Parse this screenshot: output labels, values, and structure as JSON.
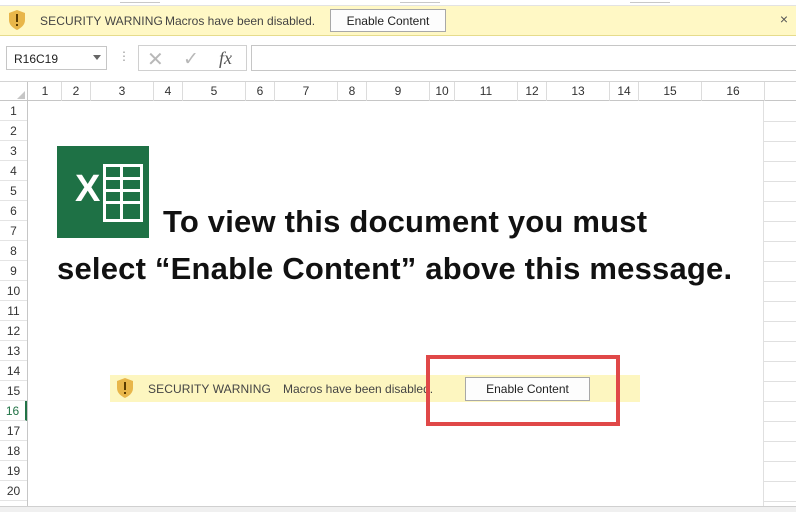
{
  "security_bar": {
    "title": "SECURITY WARNING",
    "message": "Macros have been disabled.",
    "button_label": "Enable Content",
    "close_glyph": "×"
  },
  "formula_bar": {
    "name_box_value": "R16C19",
    "dots": "⋮",
    "cancel_glyph": "✕",
    "enter_glyph": "✓",
    "function_label": "fx",
    "formula_value": ""
  },
  "columns": [
    "1",
    "2",
    "3",
    "4",
    "5",
    "6",
    "7",
    "8",
    "9",
    "10",
    "11",
    "12",
    "13",
    "14",
    "15",
    "16"
  ],
  "rows": [
    "1",
    "2",
    "3",
    "4",
    "5",
    "6",
    "7",
    "8",
    "9",
    "10",
    "11",
    "12",
    "13",
    "14",
    "15",
    "16",
    "17",
    "18",
    "19",
    "20"
  ],
  "selected_row": "16",
  "lure": {
    "logo_letter": "X",
    "line1": "To view this document you must",
    "line2": "select “Enable Content” above this message.",
    "embedded_bar": {
      "title": "SECURITY WARNING",
      "message": "Macros have been disabled.",
      "button_label": "Enable Content"
    }
  },
  "colors": {
    "security_bar_bg": "#fff8c5",
    "excel_green": "#1e7145",
    "highlight_red": "#e04848",
    "selected_header": "#217346"
  }
}
